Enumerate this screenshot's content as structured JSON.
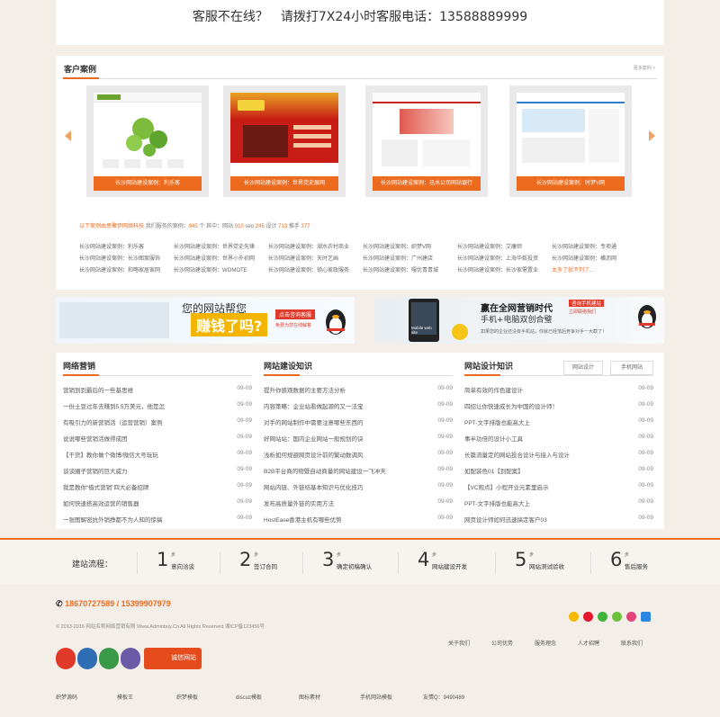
{
  "hotline": {
    "text": "客服不在线？　请拨打7X24小时客服电话：13588889999"
  },
  "cases": {
    "title": "客户案例",
    "more": "更多案例 >",
    "thumbs": [
      {
        "caption": "长沙网站建设案例：利乐客"
      },
      {
        "caption": "长沙网站建设案例：世界党史展网"
      },
      {
        "caption": "长沙网站建设案例：迅水公司网站银行"
      },
      {
        "caption": "长沙网站建设案例：时梦V网"
      }
    ],
    "stats": {
      "intro": "以下案例由思聚伊网络科技",
      "served": "我们服务的案例：",
      "total": "945",
      "unit_pre": "个 其中：网站",
      "sites": "910",
      "seo": "seo",
      "seo_n": "245",
      "design": "设计",
      "design_n": "713",
      "promo": "推手",
      "promo_n": "377"
    },
    "grid": [
      "长沙网站建设案例：利乐客",
      "长沙网站建设案例：世界党史先锋",
      "长沙网站建设案例：湖水农村商业",
      "长沙网站建设案例：织梦V网",
      "长沙网站建设案例：艾康师",
      "长沙网站建设案例：专项通",
      "长沙网站建设案例：长沙图案服饰",
      "长沙网站建设案例：世界小外初网",
      "长沙网站建设案例：天时艺画",
      "长沙网站建设案例：广州建店",
      "长沙网站建设案例：上海华毅投资",
      "长沙网站建设案例：横沥网",
      "长沙网站建设案例：和略家居家网",
      "长沙网站建设案例：WOMOTE",
      "长沙网站建设案例：锁心家政服务",
      "长沙网站建设案例：嘎优青青城",
      "长沙网站建设案例：长沙家需置业",
      "太多了就不列了..."
    ]
  },
  "banners": {
    "left": {
      "line1": "您的网站帮您",
      "line2": "赚钱了吗?",
      "cta": "点击咨询客服",
      "sub": "免费为您在线解答"
    },
    "right": {
      "line1": "赢在全网营销时代",
      "line2": "手机+电脑双创合璧",
      "cta": "咨询手机建站",
      "cta2": "立即联络我们",
      "desc": "如果您的企业还没有手机站，你就已经落后竞争对手一大截了！",
      "phone_label": "Mobile web site"
    }
  },
  "news": [
    {
      "title": "网络营销",
      "items": [
        [
          "营销到到最后的一些基思维",
          "09-09"
        ],
        [
          "一份土豆过年去赚到5.5万美元，他是怎",
          "09-09"
        ],
        [
          "有吸引力的新营销活（运营营销）案例",
          "09-09"
        ],
        [
          "说说哪些营销活做得成团",
          "09-09"
        ],
        [
          "【干货】教你做个微博/微信大号玩玩",
          "09-09"
        ],
        [
          "谈谈圈子营销的巨大威力",
          "09-09"
        ],
        [
          "我是教你“借式营销”四大必备招牌",
          "09-09"
        ],
        [
          "如何快速搭高效运营的销售器",
          "09-09"
        ],
        [
          "一张图解密抗外销挣都不为人知的惊搞",
          "09-09"
        ]
      ]
    },
    {
      "title": "网站建设知识",
      "items": [
        [
          "提升你感观数据的主要方法分析",
          "09-09"
        ],
        [
          "内容策略：企业站看做起源的又一法宝",
          "09-09"
        ],
        [
          "对手的网站制作中需要注意哪些东西的",
          "09-09"
        ],
        [
          "好网站站：国内企业网站一般规划的诀",
          "09-09"
        ],
        [
          "浅析如何规避网页设计前的繁动数调风",
          "09-09"
        ],
        [
          "B2B平台商的物暨自动商量的网站建设一飞冲天",
          "09-09"
        ],
        [
          "网站内链、外链结基本知识与优化技巧",
          "09-09"
        ],
        [
          "发布高质量外链的实用方法",
          "09-09"
        ],
        [
          "HostEase香港主机有哪些优势",
          "09-09"
        ]
      ]
    },
    {
      "title": "网站设计知识",
      "tabs": [
        "网站设计",
        "手机网站"
      ],
      "items": [
        [
          "简单有效的作色建设计",
          "09-09"
        ],
        [
          "四招让你快速成长为中国的设计师！",
          "09-09"
        ],
        [
          "PPT-文字排版也能高大上",
          "09-09"
        ],
        [
          "事半功倍的设计小工具",
          "09-09"
        ],
        [
          "长篇流量定的网站投合设计与接入与设计",
          "09-09"
        ],
        [
          "如配装色01【到配案】",
          "09-09"
        ],
        [
          "【VC观点】小程开业元素里启示",
          "09-09"
        ],
        [
          "PPT-文字排版也能高大上",
          "09-09"
        ],
        [
          "网页设计师如何迅速搞定客户03",
          "09-09"
        ]
      ]
    }
  ],
  "steps": {
    "label": "建站流程：",
    "step_word": "步",
    "items": [
      {
        "n": "1",
        "text": "意向洽谈"
      },
      {
        "n": "2",
        "text": "签订合同"
      },
      {
        "n": "3",
        "text": "确定初稿确认"
      },
      {
        "n": "4",
        "text": "网站建设开发"
      },
      {
        "n": "5",
        "text": "网站测试验收"
      },
      {
        "n": "6",
        "text": "售后服务"
      }
    ]
  },
  "footer": {
    "phones": "18670727589 / 15399907979",
    "copyright": "© 2013-2016 网站名称网络营销有限 Www.Adminbuy.Cn All Rights Reserved 湘ICP备123456号",
    "links": [
      "关于我们",
      "公司优势",
      "服务理念",
      "人才招聘",
      "联系我们"
    ],
    "honest": "诚信网站",
    "friend_links": [
      "织梦源码",
      "模板王",
      "织梦模板",
      "discuz模板",
      "图标素材",
      "手机网站模板",
      "友情Q：9490489"
    ]
  },
  "colors": {
    "accent": "#ec6b1e",
    "bg": "#f3efe8"
  }
}
